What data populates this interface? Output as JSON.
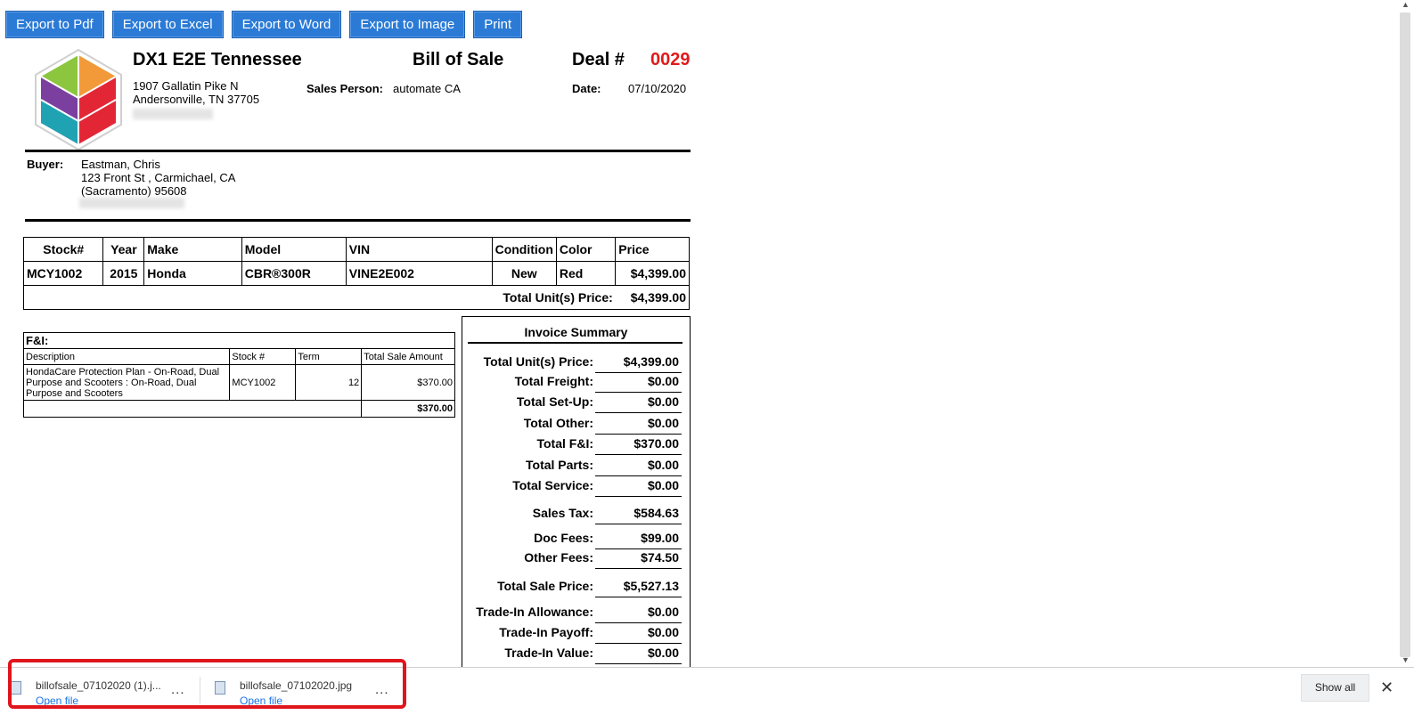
{
  "toolbar": {
    "buttons": [
      "Export to Pdf",
      "Export to Excel",
      "Export to Word",
      "Export to Image",
      "Print"
    ]
  },
  "header": {
    "company": "DX1 E2E Tennessee",
    "address_line1": "1907 Gallatin Pike N",
    "address_line2": "Andersonville, TN 37705",
    "title": "Bill of Sale",
    "sales_person_label": "Sales Person:",
    "sales_person": "automate CA",
    "deal_label": "Deal #",
    "deal_number": "0029",
    "date_label": "Date:",
    "date": "07/10/2020"
  },
  "buyer": {
    "label": "Buyer:",
    "name": "Eastman, Chris",
    "street": "123 Front St , Carmichael, CA",
    "city": "(Sacramento) 95608"
  },
  "units": {
    "headers": [
      "Stock#",
      "Year",
      "Make",
      "Model",
      "VIN",
      "Condition",
      "Color",
      "Price"
    ],
    "row": {
      "stock": "MCY1002",
      "year": "2015",
      "make": "Honda",
      "model": "CBR®300R",
      "vin": "VINE2E002",
      "condition": "New",
      "color": "Red",
      "price": "$4,399.00"
    },
    "total_label": "Total Unit(s) Price:",
    "total_value": "$4,399.00"
  },
  "fi": {
    "title": "F&I:",
    "headers": [
      "Description",
      "Stock #",
      "Term",
      "Total Sale Amount"
    ],
    "row": {
      "description": "HondaCare Protection Plan - On-Road, Dual Purpose and Scooters : On-Road, Dual Purpose and Scooters",
      "stock": "MCY1002",
      "term": "12",
      "amount": "$370.00"
    },
    "total": "$370.00"
  },
  "summary": {
    "title": "Invoice Summary",
    "rows": [
      {
        "label": "Total Unit(s) Price:",
        "value": "$4,399.00"
      },
      {
        "label": "Total Freight:",
        "value": "$0.00"
      },
      {
        "label": "Total Set-Up:",
        "value": "$0.00"
      },
      {
        "label": "Total Other:",
        "value": "$0.00"
      },
      {
        "label": "Total F&I:",
        "value": "$370.00"
      },
      {
        "label": "Total Parts:",
        "value": "$0.00"
      },
      {
        "label": "Total Service:",
        "value": "$0.00"
      },
      {
        "label": "Sales Tax:",
        "value": "$584.63"
      },
      {
        "label": "Doc Fees:",
        "value": "$99.00"
      },
      {
        "label": "Other Fees:",
        "value": "$74.50"
      },
      {
        "label": "Total Sale Price:",
        "value": "$5,527.13"
      },
      {
        "label": "Trade-In Allowance:",
        "value": "$0.00"
      },
      {
        "label": "Trade-In Payoff:",
        "value": "$0.00"
      },
      {
        "label": "Trade-In Value:",
        "value": "$0.00"
      }
    ]
  },
  "downloads": {
    "items": [
      {
        "name": "billofsale_07102020 (1).j...",
        "action": "Open file"
      },
      {
        "name": "billofsale_07102020.jpg",
        "action": "Open file"
      }
    ],
    "more": "...",
    "show_all": "Show all",
    "close": "✕"
  },
  "colors": {
    "button_blue": "#2b7bd6",
    "deal_red": "#e01b1b",
    "highlight_red": "#e0151c",
    "link_blue": "#1a73e8"
  }
}
